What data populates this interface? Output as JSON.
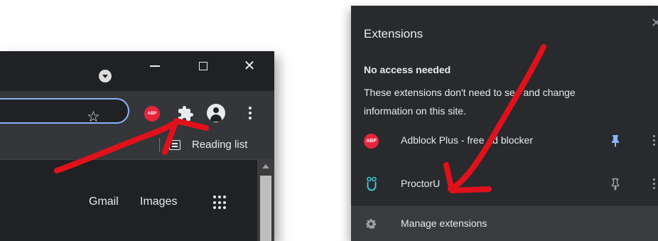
{
  "browser": {
    "window_controls": {
      "minimize": "—",
      "maximize": "☐",
      "close": "✕"
    },
    "toolbar": {
      "abp_badge": "ABP"
    },
    "bookmarks_bar": {
      "reading_list": "Reading list"
    },
    "page": {
      "gmail": "Gmail",
      "images": "Images"
    }
  },
  "extensions_popup": {
    "title": "Extensions",
    "close": "✕",
    "section_heading": "No access needed",
    "section_description": "These extensions don't need to see and change information on this site.",
    "items": [
      {
        "icon_text": "ABP",
        "name": "Adblock Plus - free ad blocker",
        "pinned": true
      },
      {
        "name": "ProctorU",
        "pinned": false
      }
    ],
    "manage_label": "Manage extensions"
  },
  "colors": {
    "panel_bg": "#292a2d",
    "toolbar_bg": "#35363a",
    "accent_blue": "#8ab4f8",
    "abp_red": "#e8243c",
    "proctoru_teal": "#3cc6d6",
    "annotation_red": "#e0111b"
  },
  "icons": [
    "profile-dropdown-icon",
    "star-icon",
    "extensions-puzzle-icon",
    "avatar-icon",
    "kebab-menu-icon",
    "reading-list-icon",
    "apps-grid-icon",
    "pin-icon",
    "gear-icon"
  ]
}
